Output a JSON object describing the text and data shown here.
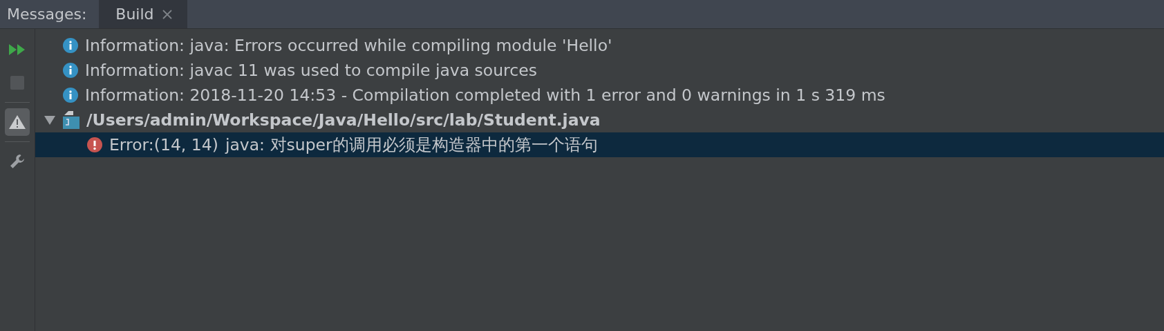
{
  "header": {
    "label": "Messages:",
    "tabs": [
      {
        "label": "Build",
        "selected": true,
        "closable": true
      }
    ]
  },
  "toolbar": [
    {
      "kind": "rerun",
      "disabled": false,
      "selected": false
    },
    {
      "kind": "stop",
      "disabled": true,
      "selected": false
    },
    {
      "kind": "warnings",
      "disabled": false,
      "selected": true
    },
    {
      "kind": "settings",
      "disabled": false,
      "selected": false
    }
  ],
  "messages": [
    {
      "kind": "info",
      "text": "Information: java: Errors occurred while compiling module 'Hello'",
      "selected": false
    },
    {
      "kind": "info",
      "text": "Information: javac 11 was used to compile java sources",
      "selected": false
    },
    {
      "kind": "info",
      "text": "Information: 2018-11-20 14:53 - Compilation completed with 1 error and 0 warnings in 1 s 319 ms",
      "selected": false
    },
    {
      "kind": "file",
      "text": "/Users/admin/Workspace/Java/Hello/src/lab/Student.java",
      "expanded": true,
      "selected": false,
      "children": [
        {
          "kind": "error",
          "location": "Error:(14, 14)",
          "text": "java: 对super的调用必须是构造器中的第一个语句",
          "selected": true
        }
      ]
    }
  ]
}
